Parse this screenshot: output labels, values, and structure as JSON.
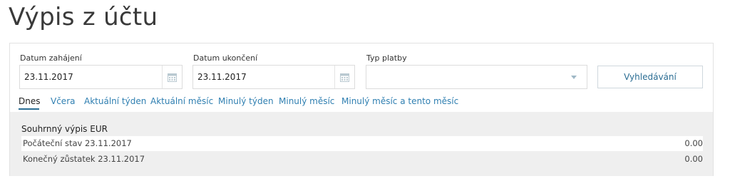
{
  "page": {
    "title": "Výpis z účtu"
  },
  "filters": {
    "start_date": {
      "label": "Datum zahájení",
      "value": "23.11.2017",
      "icon": "calendar-icon"
    },
    "end_date": {
      "label": "Datum ukončení",
      "value": "23.11.2017",
      "icon": "calendar-icon"
    },
    "payment_type": {
      "label": "Typ platby",
      "value": "",
      "icon": "chevron-down-icon"
    },
    "search_label": "Vyhledávání"
  },
  "tabs": [
    {
      "label": "Dnes",
      "active": true
    },
    {
      "label": "Včera"
    },
    {
      "label": "Aktuální týden"
    },
    {
      "label": "Aktuální měsíc"
    },
    {
      "label": "Minulý týden"
    },
    {
      "label": "Minulý měsíc"
    },
    {
      "label": "Minulý měsíc a tento měsíc"
    }
  ],
  "summary": {
    "title": "Souhrnný výpis EUR",
    "rows": [
      {
        "label": "Počáteční stav 23.11.2017",
        "amount": "0.00"
      },
      {
        "label": "Konečný zůstatek 23.11.2017",
        "amount": "0.00"
      }
    ]
  },
  "colors": {
    "accent": "#2b6d93",
    "link": "#2f7fb1",
    "summary_bg": "#efefef"
  }
}
